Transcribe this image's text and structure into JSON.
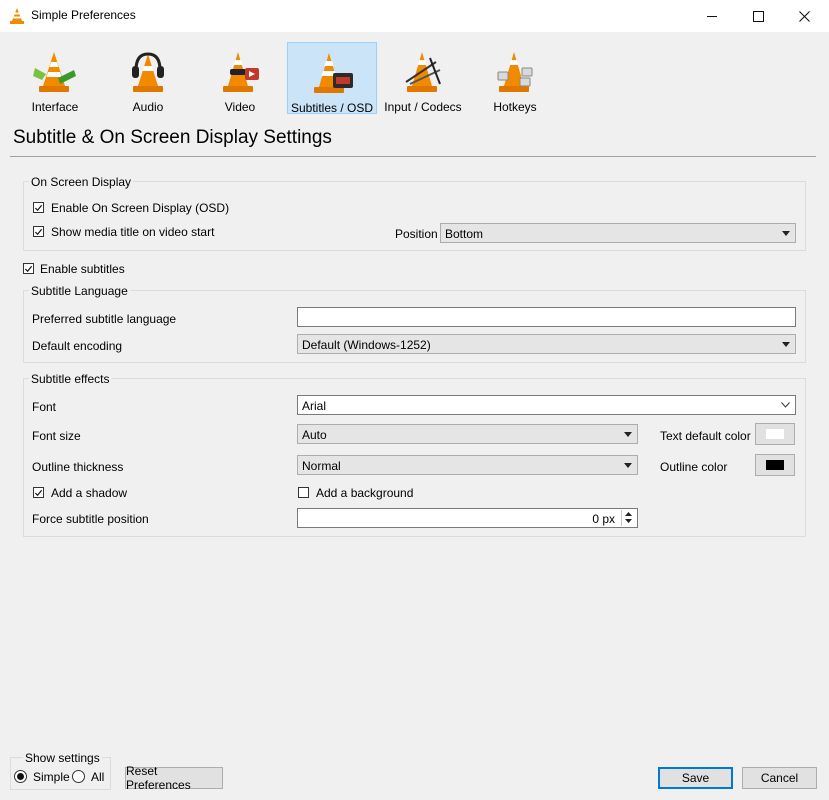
{
  "window": {
    "title": "Simple Preferences",
    "controls": [
      "minimize",
      "maximize",
      "close"
    ]
  },
  "categories": [
    {
      "label": "Interface",
      "icon": "interface-icon",
      "selected": false
    },
    {
      "label": "Audio",
      "icon": "audio-icon",
      "selected": false
    },
    {
      "label": "Video",
      "icon": "video-icon",
      "selected": false
    },
    {
      "label": "Subtitles / OSD",
      "icon": "subtitles-osd-icon",
      "selected": true
    },
    {
      "label": "Input / Codecs",
      "icon": "input-codecs-icon",
      "selected": false
    },
    {
      "label": "Hotkeys",
      "icon": "hotkeys-icon",
      "selected": false
    }
  ],
  "page_title": "Subtitle & On Screen Display Settings",
  "osd": {
    "group_title": "On Screen Display",
    "enable_osd": {
      "label": "Enable On Screen Display (OSD)",
      "checked": true
    },
    "show_title": {
      "label": "Show media title on video start",
      "checked": true
    },
    "position_label": "Position",
    "position_value": "Bottom"
  },
  "enable_subtitles": {
    "label": "Enable subtitles",
    "checked": true
  },
  "language": {
    "group_title": "Subtitle Language",
    "preferred_label": "Preferred subtitle language",
    "preferred_value": "",
    "encoding_label": "Default encoding",
    "encoding_value": "Default (Windows-1252)"
  },
  "effects": {
    "group_title": "Subtitle effects",
    "font_label": "Font",
    "font_value": "Arial",
    "font_size_label": "Font size",
    "font_size_value": "Auto",
    "text_color_label": "Text default color",
    "text_color": "#ffffff",
    "outline_label": "Outline thickness",
    "outline_value": "Normal",
    "outline_color_label": "Outline color",
    "outline_color": "#000000",
    "shadow": {
      "label": "Add a shadow",
      "checked": true
    },
    "background": {
      "label": "Add a background",
      "checked": false
    },
    "force_position_label": "Force subtitle position",
    "force_position_value": "0 px"
  },
  "footer": {
    "show_settings_label": "Show settings",
    "simple_label": "Simple",
    "all_label": "All",
    "mode": "Simple",
    "reset_label": "Reset Preferences",
    "save_label": "Save",
    "cancel_label": "Cancel"
  },
  "colors": {
    "selection_bg": "#cce4f7",
    "selection_border": "#99d1ff",
    "accent": "#0078d7",
    "cone_orange": "#f28a00"
  }
}
